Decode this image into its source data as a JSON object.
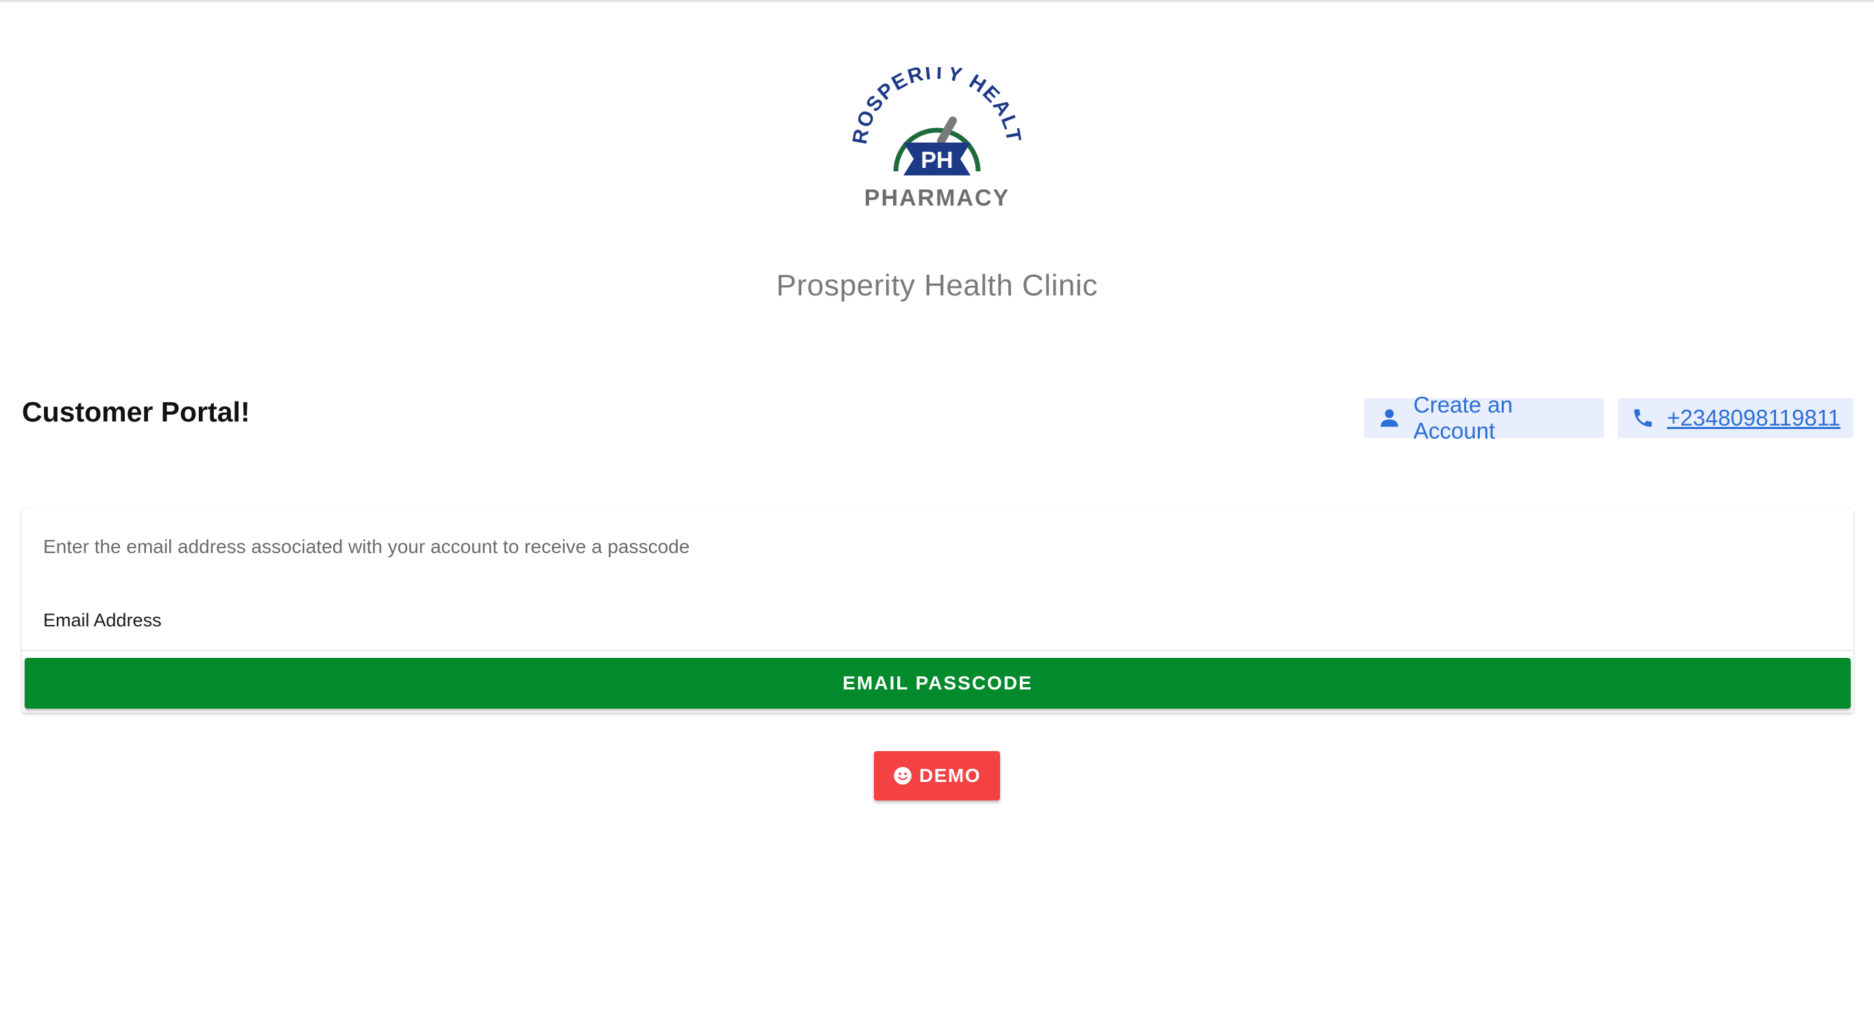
{
  "brand": {
    "logo_top_text": "PROSPERITY HEALTH",
    "logo_monogram": "PH",
    "logo_bottom_text": "PHARMACY",
    "clinic_name": "Prosperity Health Clinic",
    "colors": {
      "navy": "#1d3a87",
      "green": "#1f6a3c",
      "gray": "#6e6e6e"
    }
  },
  "header": {
    "title": "Customer Portal!",
    "create_account": {
      "label": "Create an Account",
      "icon": "person-icon"
    },
    "phone": {
      "label": "+2348098119811",
      "icon": "phone-icon"
    }
  },
  "form": {
    "instruction": "Enter the email address associated with your account to receive a passcode",
    "email_label": "Email Address",
    "email_value": "",
    "email_placeholder": "",
    "submit_label": "EMAIL PASSCODE"
  },
  "demo": {
    "label": "DEMO",
    "icon": "smiley-icon"
  },
  "colors": {
    "primary_button": "#028a2c",
    "demo_button": "#f44141",
    "chip_bg": "#e8eefc",
    "link_blue": "#2c6fd6"
  }
}
